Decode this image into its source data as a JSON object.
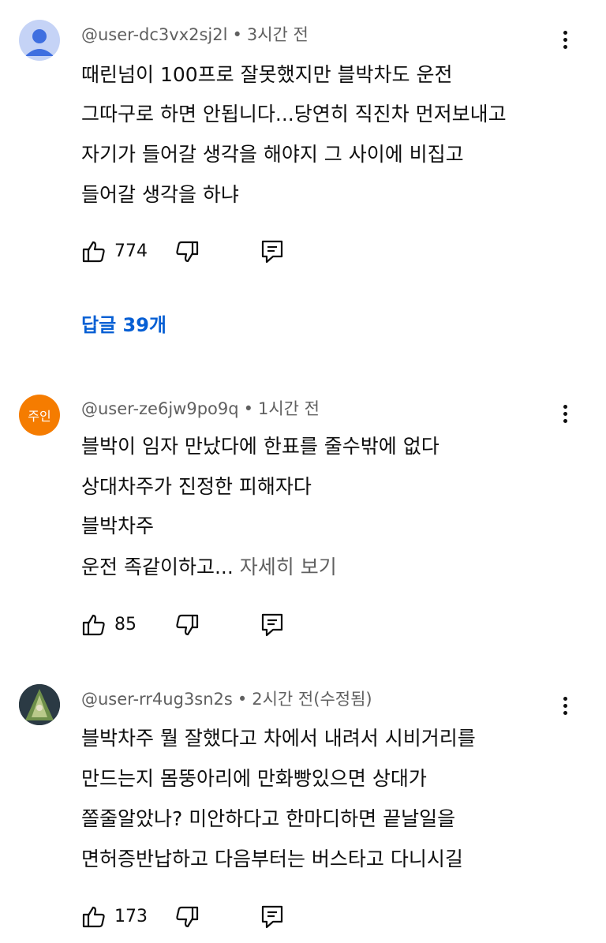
{
  "comments": [
    {
      "username": "@user-dc3vx2sj2l",
      "separator": "•",
      "time": "3시간 전",
      "lines": [
        "때린넘이 100프로 잘못했지만 블박차도 운전",
        "그따구로 하면 안됩니다...당연히 직진차 먼저보내고",
        "자기가 들어갈 생각을 해야지 그 사이에 비집고",
        "들어갈 생각을 하냐"
      ],
      "likes": "774",
      "replies_label": "답글 39개",
      "avatar": "default-person-icon"
    },
    {
      "username": "@user-ze6jw9po9q",
      "separator": "•",
      "time": "1시간 전",
      "owner_badge": "주인",
      "lines": [
        "블박이 임자 만났다에 한표를 줄수밖에 없다",
        "상대차주가 진정한 피해자다",
        "블박차주",
        "운전 족같이하고..."
      ],
      "read_more": "자세히 보기",
      "likes": "85"
    },
    {
      "username": "@user-rr4ug3sn2s",
      "separator": "•",
      "time": "2시간 전(수정됨)",
      "lines": [
        "블박차주 뭘 잘했다고 차에서 내려서 시비거리를",
        "만드는지 몸뚱아리에 만화빵있으면 상대가",
        "쫄줄알았나? 미안하다고 한마디하면 끝날일을",
        "면허증반납하고 다음부터는 버스타고 다니시길"
      ],
      "likes": "173",
      "avatar": "photo-avatar"
    }
  ],
  "colors": {
    "link_blue": "#065fd4",
    "meta_gray": "#606060",
    "text": "#0f0f0f",
    "owner_badge": "#f57c00"
  },
  "icons": [
    "like-icon",
    "dislike-icon",
    "reply-icon",
    "more-options-icon"
  ]
}
